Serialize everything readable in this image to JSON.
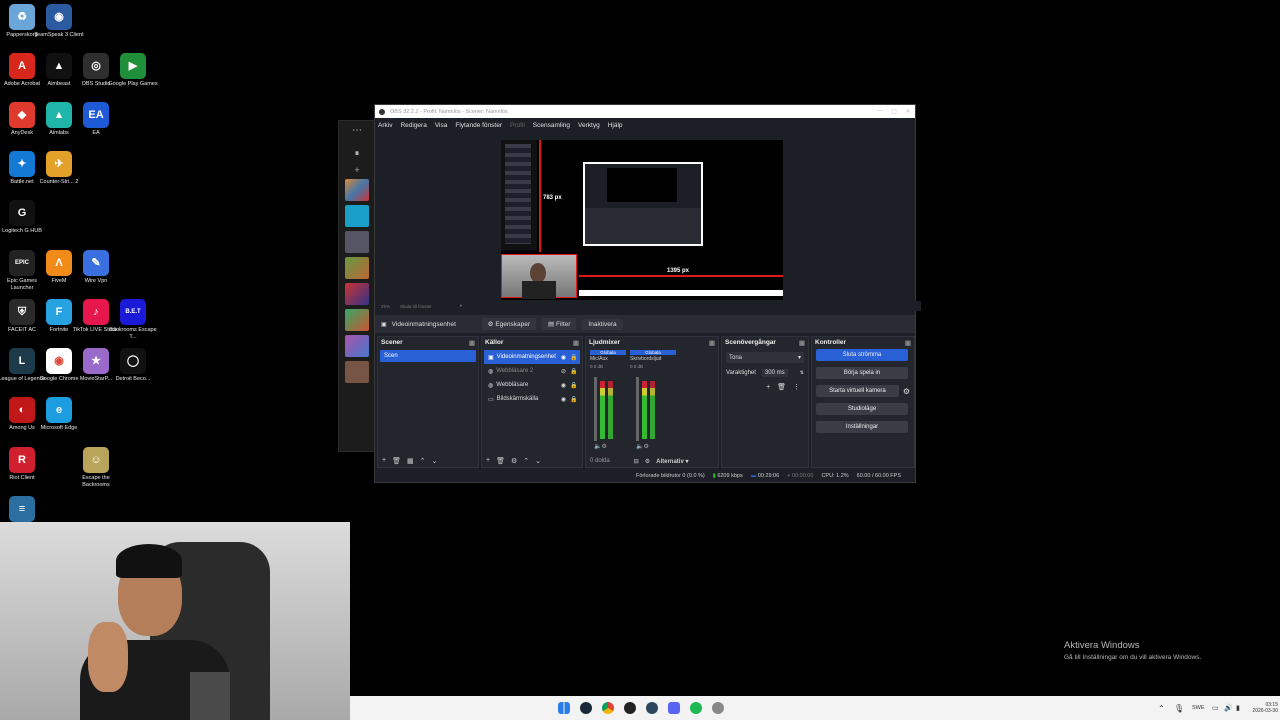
{
  "desktop_icons": [
    {
      "label": "Papperskorg",
      "color": "#6aa7d8",
      "glyph": "♻"
    },
    {
      "label": "TeamSpeak 3 Client",
      "color": "#2c5aa0",
      "glyph": "◉"
    },
    {
      "label": "Adobe Acrobat",
      "color": "#d7261c",
      "glyph": "A"
    },
    {
      "label": "Aimbeast",
      "color": "#111111",
      "glyph": "▲"
    },
    {
      "label": "OBS Studio",
      "color": "#2e2e2e",
      "glyph": "◎"
    },
    {
      "label": "Google Play Games",
      "color": "#1f8f3a",
      "glyph": "▶"
    },
    {
      "label": "AnyDesk",
      "color": "#e03a2e",
      "glyph": "◆"
    },
    {
      "label": "Aimlabs",
      "color": "#1fb5a8",
      "glyph": "▲"
    },
    {
      "label": "EA",
      "color": "#1e5ad6",
      "glyph": "EA"
    },
    {
      "label": "Battle.net",
      "color": "#1479d4",
      "glyph": "✦"
    },
    {
      "label": "Counter-Stri... 2",
      "color": "#e3a12a",
      "glyph": "✈"
    },
    {
      "label": "Logitech G HUB",
      "color": "#111111",
      "glyph": "G"
    },
    {
      "label": "Epic Games Launcher",
      "color": "#222222",
      "glyph": "EPIC"
    },
    {
      "label": "FiveM",
      "color": "#f08a18",
      "glyph": "Λ"
    },
    {
      "label": "Wire Vpn",
      "color": "#3a6fe0",
      "glyph": "✎"
    },
    {
      "label": "FACEIT AC",
      "color": "#2a2a2a",
      "glyph": "⛨"
    },
    {
      "label": "Fortnite",
      "color": "#27a2e0",
      "glyph": "F"
    },
    {
      "label": "TikTok LIVE Studio",
      "color": "#e6174d",
      "glyph": "♪"
    },
    {
      "label": "Backrooms Escape T...",
      "color": "#1a1ad8",
      "glyph": "B.E.T"
    },
    {
      "label": "League of Legends",
      "color": "#1c3a4a",
      "glyph": "L"
    },
    {
      "label": "Google Chrome",
      "color": "#ffffff",
      "glyph": "◉"
    },
    {
      "label": "MovieStarP...",
      "color": "#9a6acb",
      "glyph": "★"
    },
    {
      "label": "Detroit Beco...",
      "color": "#111111",
      "glyph": "◯"
    },
    {
      "label": "Among Us",
      "color": "#c01818",
      "glyph": "◐"
    },
    {
      "label": "Microsoft Edge",
      "color": "#1b9de0",
      "glyph": "e"
    },
    {
      "label": "Riot Client",
      "color": "#d0202e",
      "glyph": "R"
    },
    {
      "label": "Escape the Backrooms",
      "color": "#b8a45a",
      "glyph": "☺"
    },
    {
      "label": "",
      "color": "#2a6fa0",
      "glyph": "≡"
    }
  ],
  "obs": {
    "title": "OBS 32.2.2 - Profil: Namnlös - Scener: Namnlös",
    "menu": [
      "Arkiv",
      "Redigera",
      "Visa",
      "Flytande fönster",
      "Profil",
      "Scensamling",
      "Verktyg",
      "Hjälp"
    ],
    "preview": {
      "height_label": "783 px",
      "width_label": "1395 px",
      "zoom": "25%",
      "zoom_mode": "Skala till fönster"
    },
    "context_source": "Videoinmatningsenhet",
    "context_buttons": [
      "Egenskaper",
      "Filter",
      "Inaktivera"
    ],
    "scenes": {
      "title": "Scener",
      "items": [
        "Scen"
      ]
    },
    "sources": {
      "title": "Källor",
      "items": [
        {
          "label": "Videoinmatningsenhet",
          "icon": "camera-icon",
          "selected": true,
          "dim": false
        },
        {
          "label": "Webbläsare 2",
          "icon": "globe-icon",
          "selected": false,
          "dim": true
        },
        {
          "label": "Webbläsare",
          "icon": "globe-icon",
          "selected": false,
          "dim": false
        },
        {
          "label": "Bildskärmskälla",
          "icon": "monitor-icon",
          "selected": false,
          "dim": false
        }
      ]
    },
    "mixer": {
      "title": "Ljudmixer",
      "channels": [
        {
          "name": "Mic/Aux",
          "tag": "Globala",
          "level": "0.0 dB"
        },
        {
          "name": "Skrivbordsljud",
          "tag": "Globala",
          "level": "0.0 dB"
        }
      ],
      "hidden": "0 dolda",
      "options": "Alternativ"
    },
    "transitions": {
      "title": "Scenövergångar",
      "selected": "Tona",
      "duration_label": "Varaktighet",
      "duration": "300 ms"
    },
    "controls": {
      "title": "Kontroller",
      "buttons": [
        "Sluta strömma",
        "Börja spela in",
        "Starta virtuell kamera",
        "Studioläge",
        "Inställningar"
      ]
    },
    "status": {
      "dropped": "Förlorade bildrutor 0 (0.0 %)",
      "bitrate": "6209 kbps",
      "stream_time": "00:29:06",
      "rec_time": "00:00:00",
      "cpu": "CPU: 1.2%",
      "fps": "60.00 / 60.00 FPS"
    }
  },
  "watermark": {
    "title": "Aktivera Windows",
    "subtitle": "Gå till Inställningar om du vill aktivera Windows."
  },
  "taskbar": {
    "lang": "SWE",
    "time": "03:15",
    "date": "2026-03-30"
  }
}
